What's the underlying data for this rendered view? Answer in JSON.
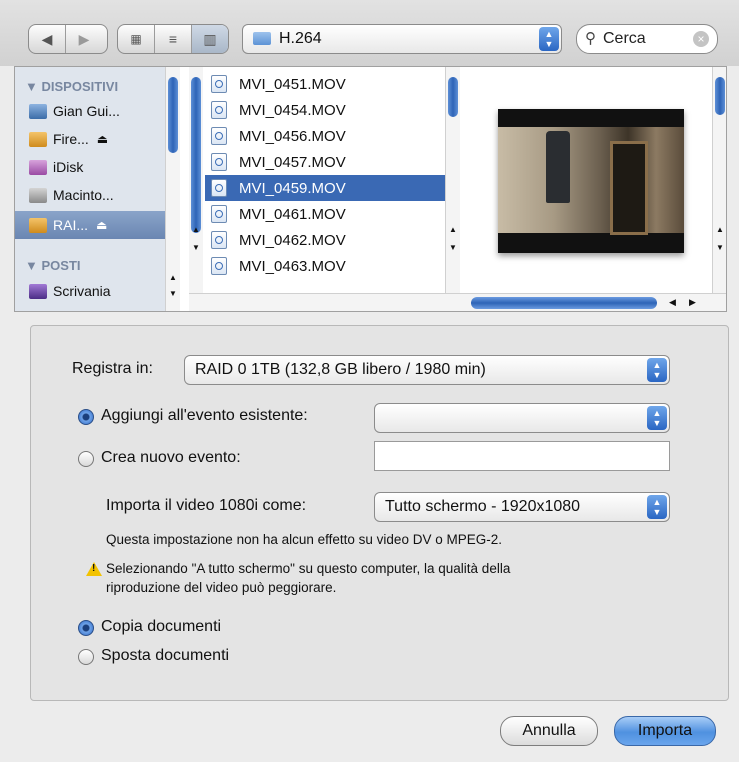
{
  "toolbar": {
    "back_icon": "back-arrow-icon",
    "forward_icon": "forward-arrow-icon",
    "view_modes": [
      "icon-view-icon",
      "list-view-icon",
      "column-view-icon"
    ],
    "path_folder": "H.264",
    "search_placeholder": "Cerca"
  },
  "sidebar": {
    "devices_header": "DISPOSITIVI",
    "places_header": "POSTI",
    "devices": [
      {
        "label": "Gian Gui...",
        "icon": "computer-icon",
        "eject": false
      },
      {
        "label": "Fire...",
        "icon": "firewire-drive-icon",
        "eject": true
      },
      {
        "label": "iDisk",
        "icon": "idisk-icon",
        "eject": false
      },
      {
        "label": "Macinto...",
        "icon": "hard-drive-icon",
        "eject": false
      },
      {
        "label": "RAI...",
        "icon": "raid-drive-icon",
        "eject": true,
        "selected": true
      }
    ],
    "places": [
      {
        "label": "Scrivania",
        "icon": "desktop-icon"
      }
    ]
  },
  "files": [
    {
      "name": "MVI_0451.MOV"
    },
    {
      "name": "MVI_0454.MOV"
    },
    {
      "name": "MVI_0456.MOV"
    },
    {
      "name": "MVI_0457.MOV"
    },
    {
      "name": "MVI_0459.MOV",
      "selected": true
    },
    {
      "name": "MVI_0461.MOV"
    },
    {
      "name": "MVI_0462.MOV"
    },
    {
      "name": "MVI_0463.MOV"
    }
  ],
  "options": {
    "save_in_label": "Registra in:",
    "save_in_value": "RAID 0 1TB (132,8 GB libero / 1980 min)",
    "add_existing_label": "Aggiungi all'evento esistente:",
    "add_existing_value": "",
    "add_existing_selected": true,
    "new_event_label": "Crea nuovo evento:",
    "new_event_value": "",
    "import_label": "Importa il video 1080i come:",
    "import_value": "Tutto schermo - 1920x1080",
    "note_text": "Questa impostazione non ha alcun effetto su video DV o MPEG-2.",
    "warning_line1": "Selezionando \"A tutto schermo\" su questo computer, la qualità della",
    "warning_line2": "riproduzione del video può peggiorare.",
    "copy_label": "Copia documenti",
    "move_label": "Sposta documenti",
    "copy_selected": true
  },
  "buttons": {
    "cancel": "Annulla",
    "import": "Importa"
  },
  "colors": {
    "selection": "#3a69b4",
    "accent_blue": "#2c67c5",
    "warning": "#f2c200"
  }
}
